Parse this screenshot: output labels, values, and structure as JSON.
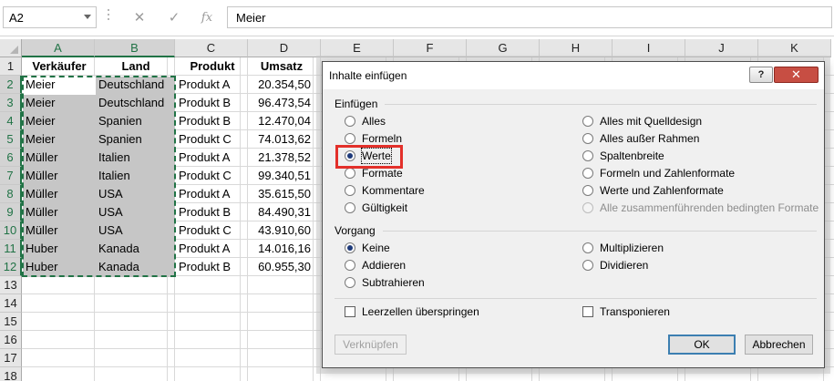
{
  "formula_bar": {
    "name_box": "A2",
    "cancel_icon": "✕",
    "enter_icon": "✓",
    "fx_icon": "fx",
    "content": "Meier"
  },
  "columns": [
    "A",
    "B",
    "C",
    "D",
    "E",
    "F",
    "G",
    "H",
    "I",
    "J",
    "K"
  ],
  "rows": [
    "1",
    "2",
    "3",
    "4",
    "5",
    "6",
    "7",
    "8",
    "9",
    "10",
    "11",
    "12",
    "13",
    "14",
    "15",
    "16",
    "17",
    "18"
  ],
  "headers": {
    "a": "Verkäufer",
    "b": "Land",
    "c": "Produkt",
    "d": "Umsatz"
  },
  "table": [
    {
      "seller": "Meier",
      "country": "Deutschland",
      "product": "Produkt A",
      "sales": "20.354,50"
    },
    {
      "seller": "Meier",
      "country": "Deutschland",
      "product": "Produkt B",
      "sales": "96.473,54"
    },
    {
      "seller": "Meier",
      "country": "Spanien",
      "product": "Produkt B",
      "sales": "12.470,04"
    },
    {
      "seller": "Meier",
      "country": "Spanien",
      "product": "Produkt C",
      "sales": "74.013,62"
    },
    {
      "seller": "Müller",
      "country": "Italien",
      "product": "Produkt A",
      "sales": "21.378,52"
    },
    {
      "seller": "Müller",
      "country": "Italien",
      "product": "Produkt C",
      "sales": "99.340,51"
    },
    {
      "seller": "Müller",
      "country": "USA",
      "product": "Produkt A",
      "sales": "35.615,50"
    },
    {
      "seller": "Müller",
      "country": "USA",
      "product": "Produkt B",
      "sales": "84.490,31"
    },
    {
      "seller": "Müller",
      "country": "USA",
      "product": "Produkt C",
      "sales": "43.910,60"
    },
    {
      "seller": "Huber",
      "country": "Kanada",
      "product": "Produkt A",
      "sales": "14.016,16"
    },
    {
      "seller": "Huber",
      "country": "Kanada",
      "product": "Produkt B",
      "sales": "60.955,30"
    }
  ],
  "dialog": {
    "title": "Inhalte einfügen",
    "help": "?",
    "close": "✕",
    "paste_group": "Einfügen",
    "paste_left": [
      {
        "label": "Alles",
        "checked": false
      },
      {
        "label": "Formeln",
        "checked": false
      },
      {
        "label": "Werte",
        "checked": true
      },
      {
        "label": "Formate",
        "checked": false
      },
      {
        "label": "Kommentare",
        "checked": false
      },
      {
        "label": "Gültigkeit",
        "checked": false
      }
    ],
    "paste_right": [
      {
        "label": "Alles mit Quelldesign",
        "checked": false
      },
      {
        "label": "Alles außer Rahmen",
        "checked": false
      },
      {
        "label": "Spaltenbreite",
        "checked": false
      },
      {
        "label": "Formeln und Zahlenformate",
        "checked": false
      },
      {
        "label": "Werte und Zahlenformate",
        "checked": false
      },
      {
        "label": "Alle zusammenführenden bedingten Formate",
        "checked": false,
        "disabled": true
      }
    ],
    "operation_group": "Vorgang",
    "operation_left": [
      {
        "label": "Keine",
        "checked": true
      },
      {
        "label": "Addieren",
        "checked": false
      },
      {
        "label": "Subtrahieren",
        "checked": false
      }
    ],
    "operation_right": [
      {
        "label": "Multiplizieren",
        "checked": false
      },
      {
        "label": "Dividieren",
        "checked": false
      }
    ],
    "skip_blanks": "Leerzellen überspringen",
    "transpose": "Transponieren",
    "link_button": "Verknüpfen",
    "ok_button": "OK",
    "cancel_button": "Abbrechen"
  }
}
